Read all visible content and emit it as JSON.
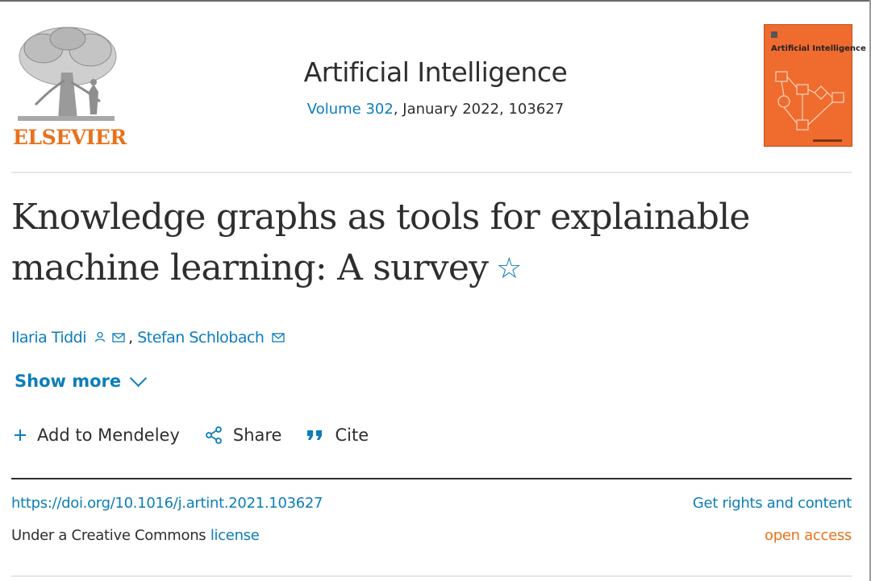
{
  "header": {
    "publisher": "ELSEVIER",
    "journal_title": "Artificial Intelligence",
    "volume_link": "Volume 302",
    "volume_rest": ", January 2022, 103627",
    "cover_title": "Artificial Intelligence"
  },
  "article": {
    "title_line1": "Knowledge graphs as tools for explainable",
    "title_line2": "machine learning: A survey",
    "star_glyph": "☆"
  },
  "authors": [
    {
      "name": "Ilaria Tiddi",
      "icons": [
        "person-icon",
        "mail-icon"
      ]
    },
    {
      "name": "Stefan Schlobach",
      "icons": [
        "mail-icon"
      ]
    }
  ],
  "author_separator": ", ",
  "show_more": "Show more",
  "actions": {
    "mendeley": "Add to Mendeley",
    "share": "Share",
    "cite": "Cite"
  },
  "footer": {
    "doi": "https://doi.org/10.1016/j.artint.2021.103627",
    "license_prefix": "Under a Creative Commons ",
    "license_link": "license",
    "rights": "Get rights and content",
    "open_access": "open access"
  },
  "colors": {
    "link_blue": "#0c7dbb",
    "elsevier_orange": "#e9711c",
    "cover_orange": "#f06b2e",
    "text": "#2e2e2e"
  }
}
